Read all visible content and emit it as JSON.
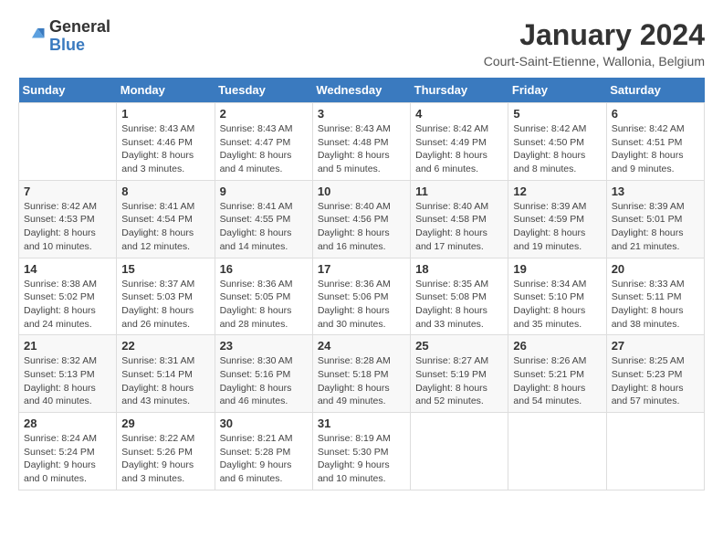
{
  "logo": {
    "line1": "General",
    "line2": "Blue"
  },
  "title": "January 2024",
  "subtitle": "Court-Saint-Etienne, Wallonia, Belgium",
  "days_of_week": [
    "Sunday",
    "Monday",
    "Tuesday",
    "Wednesday",
    "Thursday",
    "Friday",
    "Saturday"
  ],
  "weeks": [
    [
      {
        "day": "",
        "content": ""
      },
      {
        "day": "1",
        "content": "Sunrise: 8:43 AM\nSunset: 4:46 PM\nDaylight: 8 hours\nand 3 minutes."
      },
      {
        "day": "2",
        "content": "Sunrise: 8:43 AM\nSunset: 4:47 PM\nDaylight: 8 hours\nand 4 minutes."
      },
      {
        "day": "3",
        "content": "Sunrise: 8:43 AM\nSunset: 4:48 PM\nDaylight: 8 hours\nand 5 minutes."
      },
      {
        "day": "4",
        "content": "Sunrise: 8:42 AM\nSunset: 4:49 PM\nDaylight: 8 hours\nand 6 minutes."
      },
      {
        "day": "5",
        "content": "Sunrise: 8:42 AM\nSunset: 4:50 PM\nDaylight: 8 hours\nand 8 minutes."
      },
      {
        "day": "6",
        "content": "Sunrise: 8:42 AM\nSunset: 4:51 PM\nDaylight: 8 hours\nand 9 minutes."
      }
    ],
    [
      {
        "day": "7",
        "content": "Sunrise: 8:42 AM\nSunset: 4:53 PM\nDaylight: 8 hours\nand 10 minutes."
      },
      {
        "day": "8",
        "content": "Sunrise: 8:41 AM\nSunset: 4:54 PM\nDaylight: 8 hours\nand 12 minutes."
      },
      {
        "day": "9",
        "content": "Sunrise: 8:41 AM\nSunset: 4:55 PM\nDaylight: 8 hours\nand 14 minutes."
      },
      {
        "day": "10",
        "content": "Sunrise: 8:40 AM\nSunset: 4:56 PM\nDaylight: 8 hours\nand 16 minutes."
      },
      {
        "day": "11",
        "content": "Sunrise: 8:40 AM\nSunset: 4:58 PM\nDaylight: 8 hours\nand 17 minutes."
      },
      {
        "day": "12",
        "content": "Sunrise: 8:39 AM\nSunset: 4:59 PM\nDaylight: 8 hours\nand 19 minutes."
      },
      {
        "day": "13",
        "content": "Sunrise: 8:39 AM\nSunset: 5:01 PM\nDaylight: 8 hours\nand 21 minutes."
      }
    ],
    [
      {
        "day": "14",
        "content": "Sunrise: 8:38 AM\nSunset: 5:02 PM\nDaylight: 8 hours\nand 24 minutes."
      },
      {
        "day": "15",
        "content": "Sunrise: 8:37 AM\nSunset: 5:03 PM\nDaylight: 8 hours\nand 26 minutes."
      },
      {
        "day": "16",
        "content": "Sunrise: 8:36 AM\nSunset: 5:05 PM\nDaylight: 8 hours\nand 28 minutes."
      },
      {
        "day": "17",
        "content": "Sunrise: 8:36 AM\nSunset: 5:06 PM\nDaylight: 8 hours\nand 30 minutes."
      },
      {
        "day": "18",
        "content": "Sunrise: 8:35 AM\nSunset: 5:08 PM\nDaylight: 8 hours\nand 33 minutes."
      },
      {
        "day": "19",
        "content": "Sunrise: 8:34 AM\nSunset: 5:10 PM\nDaylight: 8 hours\nand 35 minutes."
      },
      {
        "day": "20",
        "content": "Sunrise: 8:33 AM\nSunset: 5:11 PM\nDaylight: 8 hours\nand 38 minutes."
      }
    ],
    [
      {
        "day": "21",
        "content": "Sunrise: 8:32 AM\nSunset: 5:13 PM\nDaylight: 8 hours\nand 40 minutes."
      },
      {
        "day": "22",
        "content": "Sunrise: 8:31 AM\nSunset: 5:14 PM\nDaylight: 8 hours\nand 43 minutes."
      },
      {
        "day": "23",
        "content": "Sunrise: 8:30 AM\nSunset: 5:16 PM\nDaylight: 8 hours\nand 46 minutes."
      },
      {
        "day": "24",
        "content": "Sunrise: 8:28 AM\nSunset: 5:18 PM\nDaylight: 8 hours\nand 49 minutes."
      },
      {
        "day": "25",
        "content": "Sunrise: 8:27 AM\nSunset: 5:19 PM\nDaylight: 8 hours\nand 52 minutes."
      },
      {
        "day": "26",
        "content": "Sunrise: 8:26 AM\nSunset: 5:21 PM\nDaylight: 8 hours\nand 54 minutes."
      },
      {
        "day": "27",
        "content": "Sunrise: 8:25 AM\nSunset: 5:23 PM\nDaylight: 8 hours\nand 57 minutes."
      }
    ],
    [
      {
        "day": "28",
        "content": "Sunrise: 8:24 AM\nSunset: 5:24 PM\nDaylight: 9 hours\nand 0 minutes."
      },
      {
        "day": "29",
        "content": "Sunrise: 8:22 AM\nSunset: 5:26 PM\nDaylight: 9 hours\nand 3 minutes."
      },
      {
        "day": "30",
        "content": "Sunrise: 8:21 AM\nSunset: 5:28 PM\nDaylight: 9 hours\nand 6 minutes."
      },
      {
        "day": "31",
        "content": "Sunrise: 8:19 AM\nSunset: 5:30 PM\nDaylight: 9 hours\nand 10 minutes."
      },
      {
        "day": "",
        "content": ""
      },
      {
        "day": "",
        "content": ""
      },
      {
        "day": "",
        "content": ""
      }
    ]
  ]
}
